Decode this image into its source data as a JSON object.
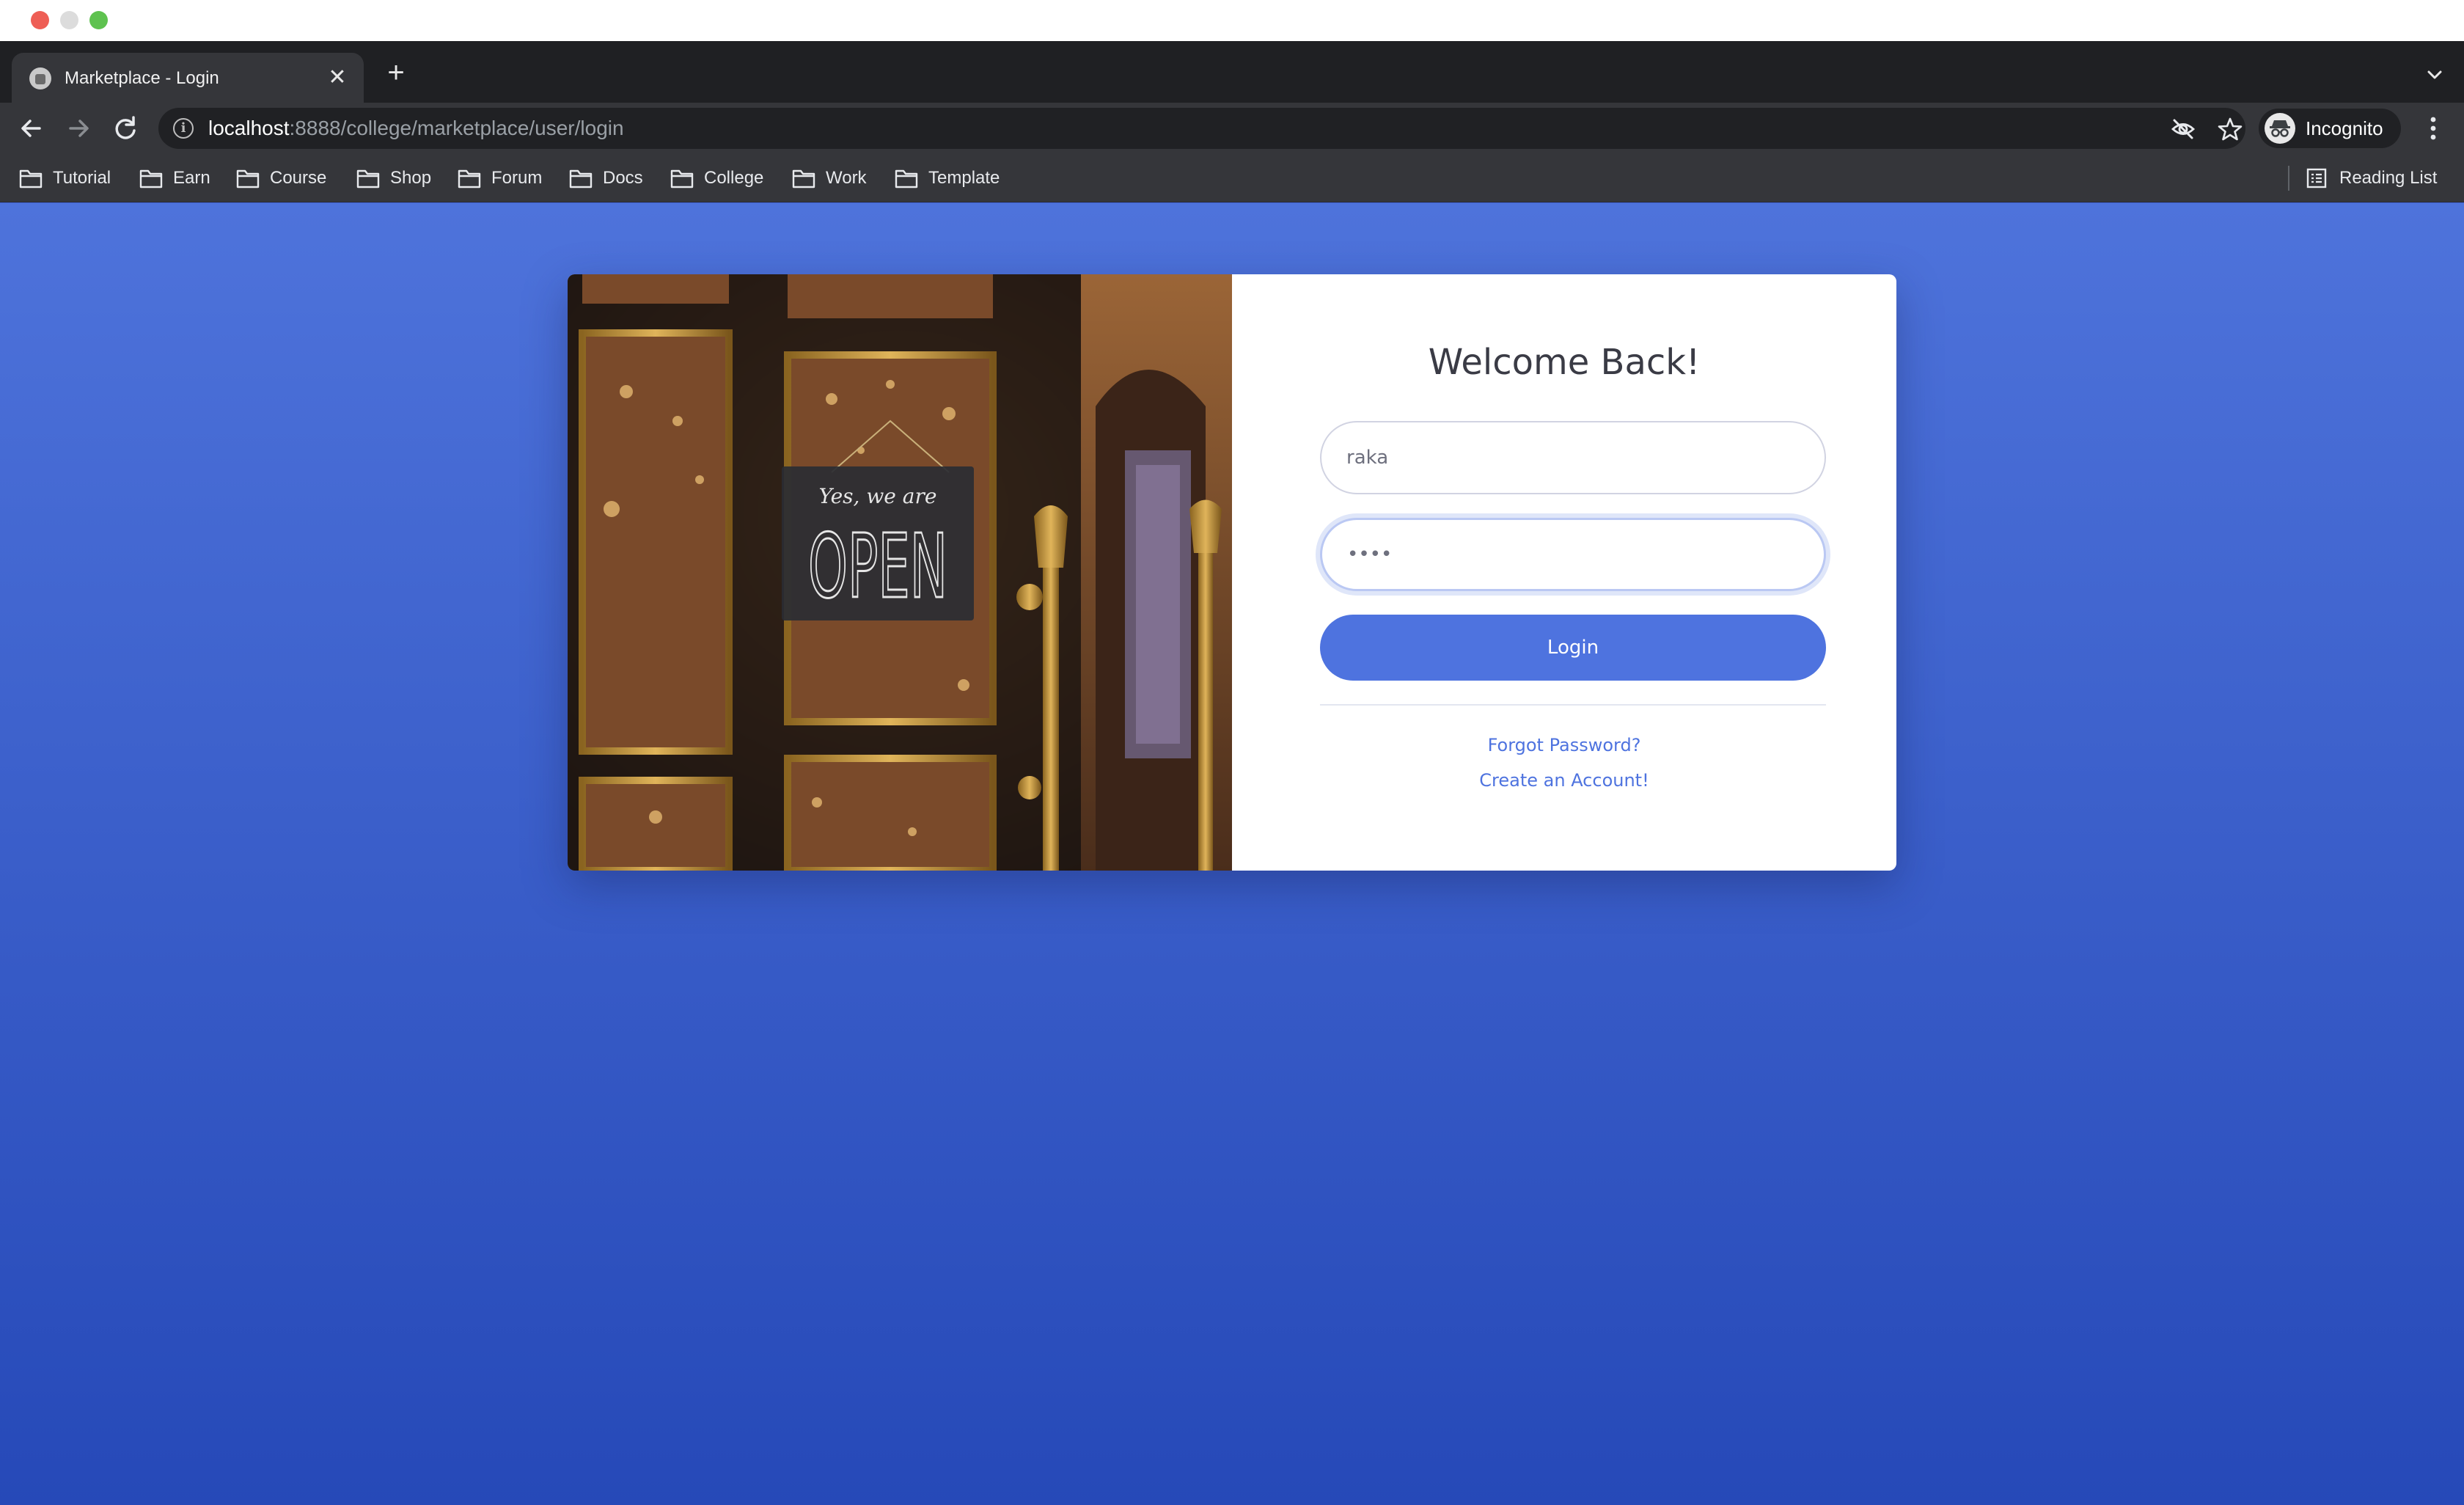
{
  "browser": {
    "tab_title": "Marketplace - Login",
    "url_host": "localhost",
    "url_path": ":8888/college/marketplace/user/login",
    "profile_label": "Incognito",
    "bookmarks": [
      "Tutorial",
      "Earn",
      "Course",
      "Shop",
      "Forum",
      "Docs",
      "College",
      "Work",
      "Template"
    ],
    "reading_list_label": "Reading List"
  },
  "login": {
    "heading": "Welcome Back!",
    "username_value": "raka",
    "password_value": "••••",
    "login_button": "Login",
    "forgot_password_link": "Forgot Password?",
    "create_account_link": "Create an Account!"
  },
  "image": {
    "sign_script": "Yes, we are",
    "sign_word": "OPEN"
  },
  "colors": {
    "accent": "#4e73df",
    "page_gradient_top": "#4e73db",
    "page_gradient_bottom": "#2649b8"
  }
}
